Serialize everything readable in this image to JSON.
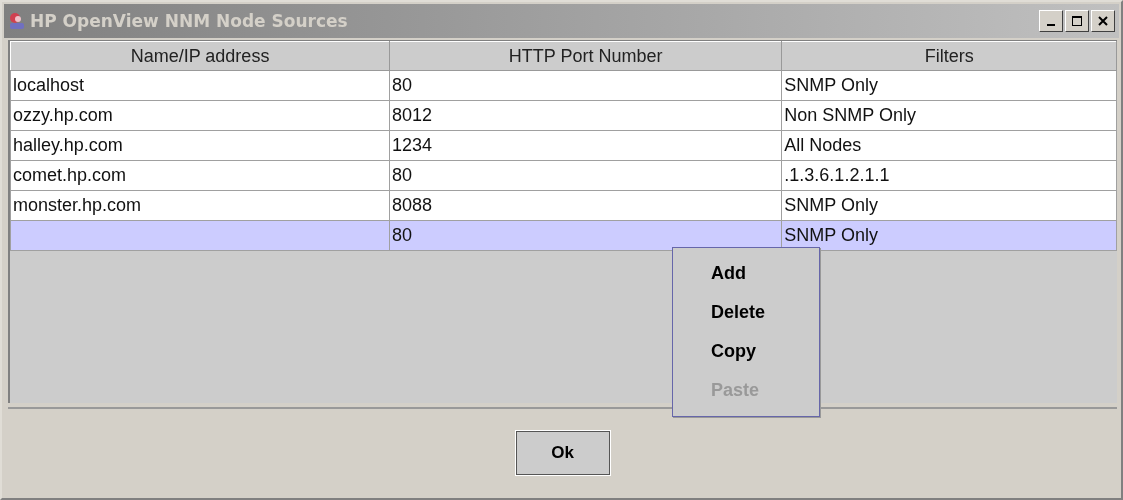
{
  "window": {
    "title": "HP OpenView NNM Node Sources"
  },
  "table": {
    "columns": [
      "Name/IP address",
      "HTTP Port Number",
      "Filters"
    ],
    "rows": [
      {
        "cells": [
          "localhost",
          "80",
          "SNMP Only"
        ],
        "selected": false
      },
      {
        "cells": [
          "ozzy.hp.com",
          "8012",
          "Non SNMP Only"
        ],
        "selected": false
      },
      {
        "cells": [
          "halley.hp.com",
          "1234",
          "All Nodes"
        ],
        "selected": false
      },
      {
        "cells": [
          "comet.hp.com",
          "80",
          ".1.3.6.1.2.1.1"
        ],
        "selected": false
      },
      {
        "cells": [
          "monster.hp.com",
          "8088",
          "SNMP Only"
        ],
        "selected": false
      },
      {
        "cells": [
          "",
          "80",
          "SNMP Only"
        ],
        "selected": true
      }
    ]
  },
  "context_menu": [
    {
      "label": "Add",
      "disabled": false
    },
    {
      "label": "Delete",
      "disabled": false
    },
    {
      "label": "Copy",
      "disabled": false
    },
    {
      "label": "Paste",
      "disabled": true
    }
  ],
  "buttons": [
    "Ok"
  ]
}
